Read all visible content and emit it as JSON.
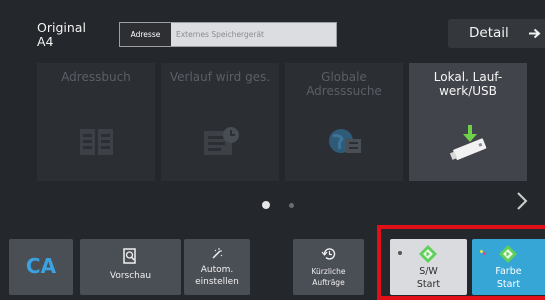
{
  "header": {
    "original_label": "Original",
    "original_size": "A4",
    "address_tag": "Adresse",
    "address_placeholder": "Externes Speichergerät",
    "detail_label": "Detail"
  },
  "tiles": [
    {
      "label": "Adressbuch",
      "state": "disabled",
      "icon": "address-book-icon"
    },
    {
      "label": "Verlauf wird ges.",
      "state": "disabled",
      "icon": "history-icon"
    },
    {
      "label": "Globale Adresssuche",
      "state": "disabled",
      "icon": "global-search-icon"
    },
    {
      "label": "Lokal. Lauf-werk/USB",
      "label_line1": "Lokal. Lauf-",
      "label_line2": "werk/USB",
      "state": "active",
      "icon": "usb-drive-icon"
    }
  ],
  "pager": {
    "current": 1,
    "total": 2
  },
  "bottom": {
    "ca_label": "CA",
    "preview_label": "Vorschau",
    "auto_line1": "Autom.",
    "auto_line2": "einstellen",
    "recent_line1": "Kürzliche",
    "recent_line2": "Aufträge",
    "bw_line1": "S/W",
    "bw_line2": "Start",
    "color_line1": "Farbe",
    "color_line2": "Start"
  },
  "colors": {
    "background": "#24272b",
    "tile_active": "#41444a",
    "ca_text": "#3aa2e0",
    "color_start": "#35a6d6",
    "bw_start": "#d9dbde",
    "highlight_frame": "#e01018",
    "start_diamond": "#5fd05a"
  }
}
